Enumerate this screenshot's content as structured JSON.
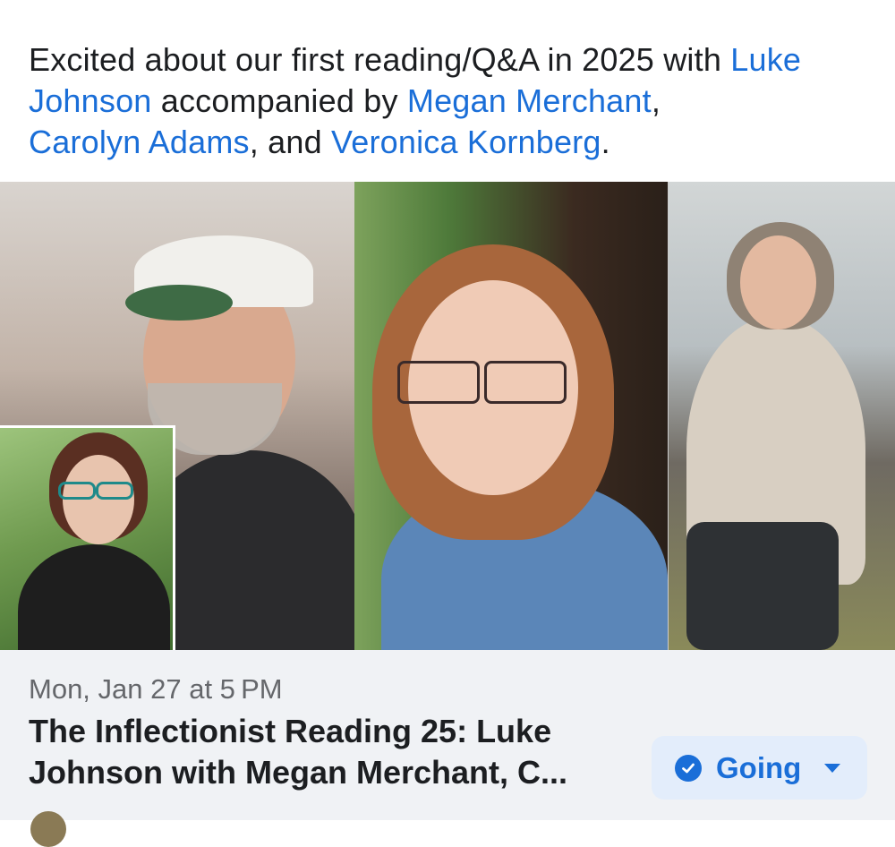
{
  "post": {
    "text_intro": "Excited about our first reading/Q&A in 2025 with ",
    "link_luke": "Luke Johnson",
    "text_mid1": " accompanied by ",
    "link_megan": "Megan Merchant",
    "text_comma": ", ",
    "link_carolyn": "Carolyn Adams",
    "text_and": ", and ",
    "link_veronica": "Veronica Kornberg",
    "text_end": "."
  },
  "event": {
    "date": "Mon, Jan 27 at 5 PM",
    "title": "The Inflectionist Reading 25: Luke Johnson with Megan Merchant, C...",
    "going_label": "Going"
  },
  "colors": {
    "link": "#1a6ed8",
    "card_bg": "#f0f2f5",
    "button_bg": "#e3edfb"
  },
  "icons": {
    "going_check": "check-circle-icon",
    "going_caret": "caret-down-icon"
  }
}
